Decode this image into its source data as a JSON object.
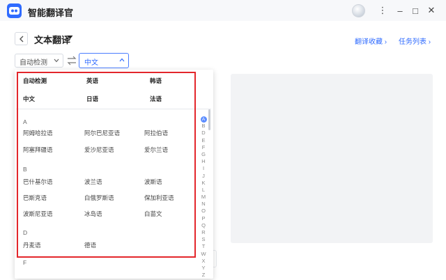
{
  "app": {
    "title": "智能翻译官"
  },
  "window": {
    "menu_icon": "⋮",
    "minimize": "–",
    "maximize": "□",
    "close": "✕"
  },
  "header": {
    "title": "文本翻译",
    "links": [
      "翻译收藏 ›",
      "任务列表 ›"
    ]
  },
  "language_bar": {
    "source_value": "自动检测",
    "target_value": "中文"
  },
  "dropdown": {
    "common": [
      "自动检测",
      "英语",
      "韩语",
      "中文",
      "日语",
      "法语"
    ],
    "groups": [
      {
        "letter": "A",
        "items": [
          "阿姆哈拉语",
          "阿尔巴尼亚语",
          "阿拉伯语",
          "阿塞拜疆语",
          "爱沙尼亚语",
          "爱尔兰语"
        ]
      },
      {
        "letter": "B",
        "items": [
          "巴什基尔语",
          "波兰语",
          "波斯语",
          "巴斯克语",
          "白俄罗斯语",
          "保加利亚语",
          "波斯尼亚语",
          "冰岛语",
          "白苗文"
        ]
      },
      {
        "letter": "D",
        "items": [
          "丹麦语",
          "德语"
        ]
      },
      {
        "letter": "F",
        "items": []
      }
    ],
    "index": [
      "A",
      "B",
      "D",
      "E",
      "F",
      "G",
      "H",
      "I",
      "J",
      "K",
      "L",
      "M",
      "N",
      "O",
      "P",
      "Q",
      "R",
      "S",
      "T",
      "W",
      "X",
      "Y",
      "Z"
    ],
    "active_index": "A"
  },
  "colors": {
    "accent": "#2f6bff",
    "highlight_box": "#e3262b"
  }
}
